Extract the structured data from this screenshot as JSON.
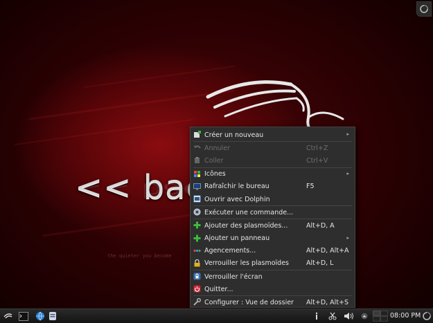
{
  "desktop": {
    "wallpaper_text": "<< back",
    "wallpaper_motto": "the quieter you become"
  },
  "menu": {
    "items": [
      {
        "label": "Créer un nouveau",
        "shortcut": "",
        "submenu": true,
        "disabled": false,
        "icon": "new-icon"
      },
      {
        "label": "Annuler",
        "shortcut": "Ctrl+Z",
        "submenu": false,
        "disabled": true,
        "icon": "undo-icon"
      },
      {
        "label": "Coller",
        "shortcut": "Ctrl+V",
        "submenu": false,
        "disabled": true,
        "icon": "paste-icon"
      },
      {
        "label": "Icônes",
        "shortcut": "",
        "submenu": true,
        "disabled": false,
        "icon": "icons-icon"
      },
      {
        "label": "Rafraîchir le bureau",
        "shortcut": "F5",
        "submenu": false,
        "disabled": false,
        "icon": "refresh-icon"
      },
      {
        "label": "Ouvrir avec Dolphin",
        "shortcut": "",
        "submenu": false,
        "disabled": false,
        "icon": "dolphin-icon"
      },
      {
        "label": "Exécuter une commande...",
        "shortcut": "",
        "submenu": false,
        "disabled": false,
        "icon": "run-command-icon"
      },
      {
        "label": "Ajouter des plasmoïdes...",
        "shortcut": "Alt+D, A",
        "submenu": false,
        "disabled": false,
        "icon": "add-icon"
      },
      {
        "label": "Ajouter un panneau",
        "shortcut": "",
        "submenu": true,
        "disabled": false,
        "icon": "add-panel-icon"
      },
      {
        "label": "Agencements...",
        "shortcut": "Alt+D, Alt+A",
        "submenu": false,
        "disabled": false,
        "icon": "activities-icon"
      },
      {
        "label": "Verrouiller les plasmoïdes",
        "shortcut": "Alt+D, L",
        "submenu": false,
        "disabled": false,
        "icon": "lock-icon"
      },
      {
        "label": "Verrouiller l'écran",
        "shortcut": "",
        "submenu": false,
        "disabled": false,
        "icon": "lock-screen-icon"
      },
      {
        "label": "Quitter...",
        "shortcut": "",
        "submenu": false,
        "disabled": false,
        "icon": "logout-icon"
      },
      {
        "label": "Configurer : Vue de dossier",
        "shortcut": "Alt+D, Alt+S",
        "submenu": false,
        "disabled": false,
        "icon": "configure-icon"
      }
    ]
  },
  "taskbar": {
    "clock": "08:00 PM"
  },
  "colors": {
    "wallpaper_red": "#8a0c10",
    "menu_bg": "#2e2e2e",
    "accent_green": "#3cba3c"
  }
}
